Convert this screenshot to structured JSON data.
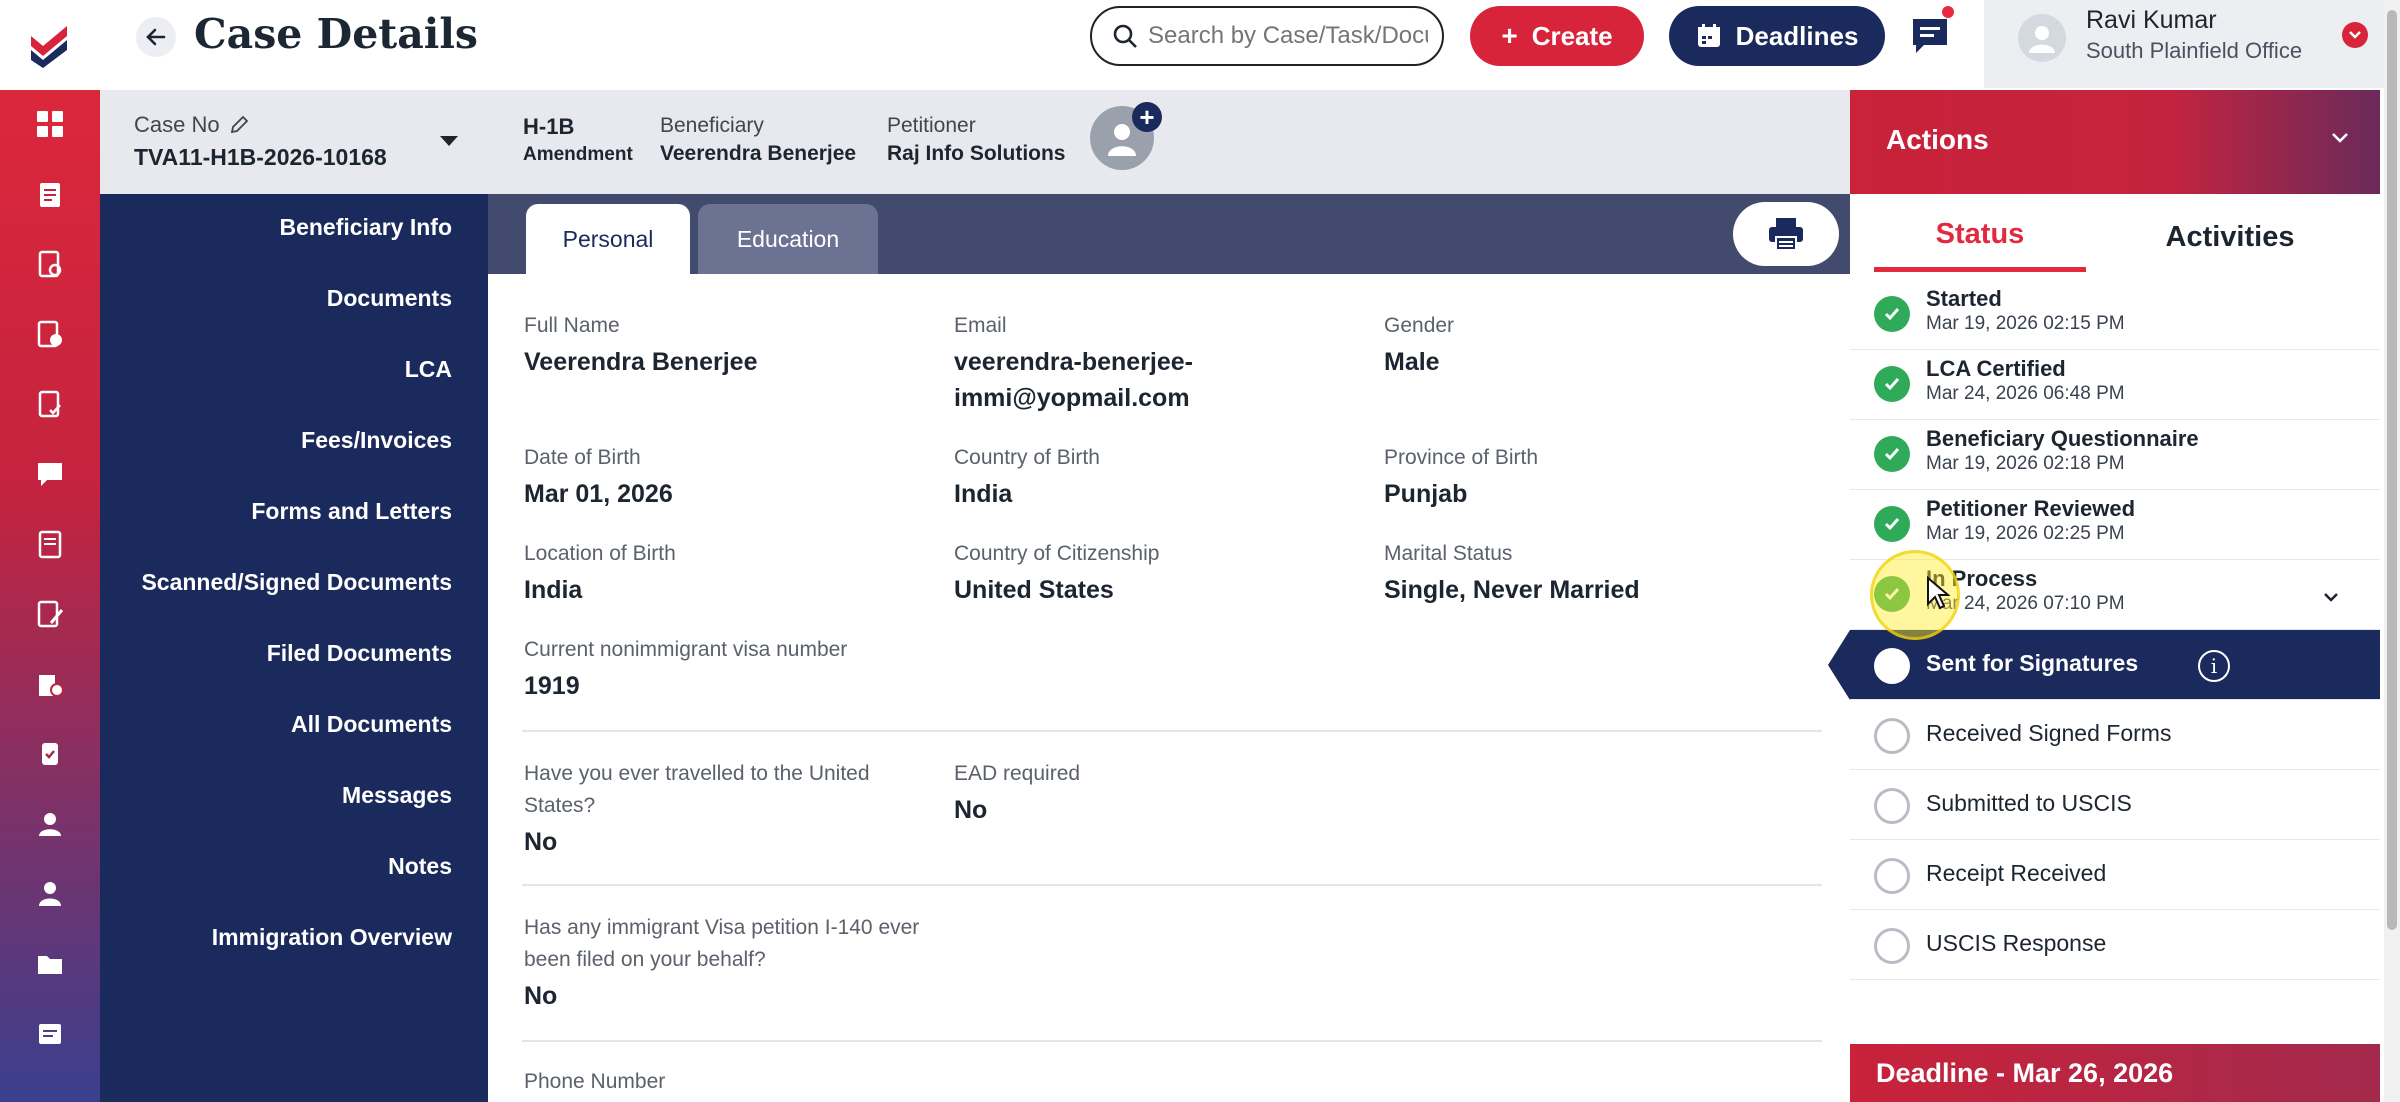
{
  "header": {
    "title": "Case Details",
    "search_placeholder": "Search by Case/Task/Document",
    "create_label": "Create",
    "deadlines_label": "Deadlines",
    "user_name": "Ravi Kumar",
    "user_office": "South Plainfield Office"
  },
  "case": {
    "case_no_label": "Case No",
    "case_no": "TVA11-H1B-2026-10168",
    "visa_type": "H-1B",
    "visa_subtype": "Amendment",
    "beneficiary_label": "Beneficiary",
    "beneficiary": "Veerendra Benerjee",
    "petitioner_label": "Petitioner",
    "petitioner": "Raj Info Solutions"
  },
  "nav": {
    "items": [
      {
        "label": "Beneficiary Info"
      },
      {
        "label": "Documents"
      },
      {
        "label": "LCA"
      },
      {
        "label": "Fees/Invoices"
      },
      {
        "label": "Forms and Letters"
      },
      {
        "label": "Scanned/Signed Documents"
      },
      {
        "label": "Filed Documents"
      },
      {
        "label": "All Documents"
      },
      {
        "label": "Messages"
      },
      {
        "label": "Notes"
      },
      {
        "label": "Immigration Overview"
      }
    ]
  },
  "tabs": {
    "personal": "Personal",
    "education": "Education"
  },
  "personal": {
    "full_name": {
      "label": "Full Name",
      "value": "Veerendra Benerjee"
    },
    "email": {
      "label": "Email",
      "value_line1": "veerendra-benerjee-",
      "value_line2": "immi@yopmail.com"
    },
    "gender": {
      "label": "Gender",
      "value": "Male"
    },
    "dob": {
      "label": "Date of Birth",
      "value": "Mar 01, 2026"
    },
    "country_birth": {
      "label": "Country of Birth",
      "value": "India"
    },
    "province_birth": {
      "label": "Province of Birth",
      "value": "Punjab"
    },
    "location_birth": {
      "label": "Location of Birth",
      "value": "India"
    },
    "citizenship": {
      "label": "Country of Citizenship",
      "value": "United States"
    },
    "marital": {
      "label": "Marital Status",
      "value": "Single, Never Married"
    },
    "visa_number": {
      "label": "Current nonimmigrant visa number",
      "value": "1919"
    },
    "travelled": {
      "label_line1": "Have you ever travelled to the United",
      "label_line2": "States?",
      "value": "No"
    },
    "ead": {
      "label": "EAD required",
      "value": "No"
    },
    "i140": {
      "label_line1": "Has any immigrant Visa petition I-140 ever",
      "label_line2": "been filed on your behalf?",
      "value": "No"
    },
    "phone": {
      "label": "Phone Number"
    }
  },
  "actions": {
    "title": "Actions",
    "tab_status": "Status",
    "tab_activities": "Activities",
    "statuses": [
      {
        "name": "Started",
        "date": "Mar 19, 2026 02:15 PM",
        "done": true
      },
      {
        "name": "LCA Certified",
        "date": "Mar 24, 2026 06:48 PM",
        "done": true
      },
      {
        "name": "Beneficiary Questionnaire",
        "date": "Mar 19, 2026 02:18 PM",
        "done": true
      },
      {
        "name": "Petitioner Reviewed",
        "date": "Mar 19, 2026 02:25 PM",
        "done": true
      },
      {
        "name": "In Process",
        "date": "Mar 24, 2026 07:10 PM",
        "done": true
      },
      {
        "name": "Sent for Signatures",
        "done": false
      },
      {
        "name": "Received Signed Forms",
        "done": false
      },
      {
        "name": "Submitted to USCIS",
        "done": false
      },
      {
        "name": "Receipt Received",
        "done": false
      },
      {
        "name": "USCIS Response",
        "done": false
      }
    ],
    "deadline": "Deadline - Mar 26, 2026"
  },
  "colors": {
    "brand_red": "#d8243b",
    "navy": "#1b2a5c",
    "success_green": "#2eaa58"
  }
}
